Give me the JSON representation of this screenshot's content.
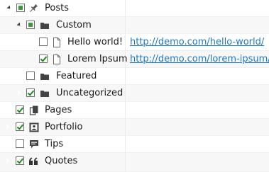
{
  "tree": {
    "items": [
      {
        "label": "Posts",
        "icon": "pin-icon",
        "check": "partial",
        "toggle": "expanded"
      },
      {
        "label": "Custom",
        "icon": "folder-icon",
        "check": "partial",
        "toggle": "expanded"
      },
      {
        "label": "Hello world!",
        "icon": "document-icon",
        "check": "unchecked",
        "toggle": "none",
        "link": "http://demo.com/hello-world/"
      },
      {
        "label": "Lorem Ipsum",
        "icon": "document-icon",
        "check": "checked",
        "toggle": "none",
        "link": "http://demo.com/lorem-ipsum/"
      },
      {
        "label": "Featured",
        "icon": "folder-icon",
        "check": "unchecked",
        "toggle": "collapsed"
      },
      {
        "label": "Uncategorized",
        "icon": "folder-icon",
        "check": "checked",
        "toggle": "collapsed"
      },
      {
        "label": "Pages",
        "icon": "pages-icon",
        "check": "checked",
        "toggle": "collapsed"
      },
      {
        "label": "Portfolio",
        "icon": "portfolio-icon",
        "check": "checked",
        "toggle": "collapsed"
      },
      {
        "label": "Tips",
        "icon": "speech-bubble-icon",
        "check": "unchecked",
        "toggle": "collapsed"
      },
      {
        "label": "Quotes",
        "icon": "quote-icon",
        "check": "checked",
        "toggle": "collapsed"
      }
    ]
  },
  "colors": {
    "link": "#1c7bc4",
    "check": "#1e8a1e",
    "partial": "#3f9a3f",
    "row_alt": "#f7f7f7"
  }
}
